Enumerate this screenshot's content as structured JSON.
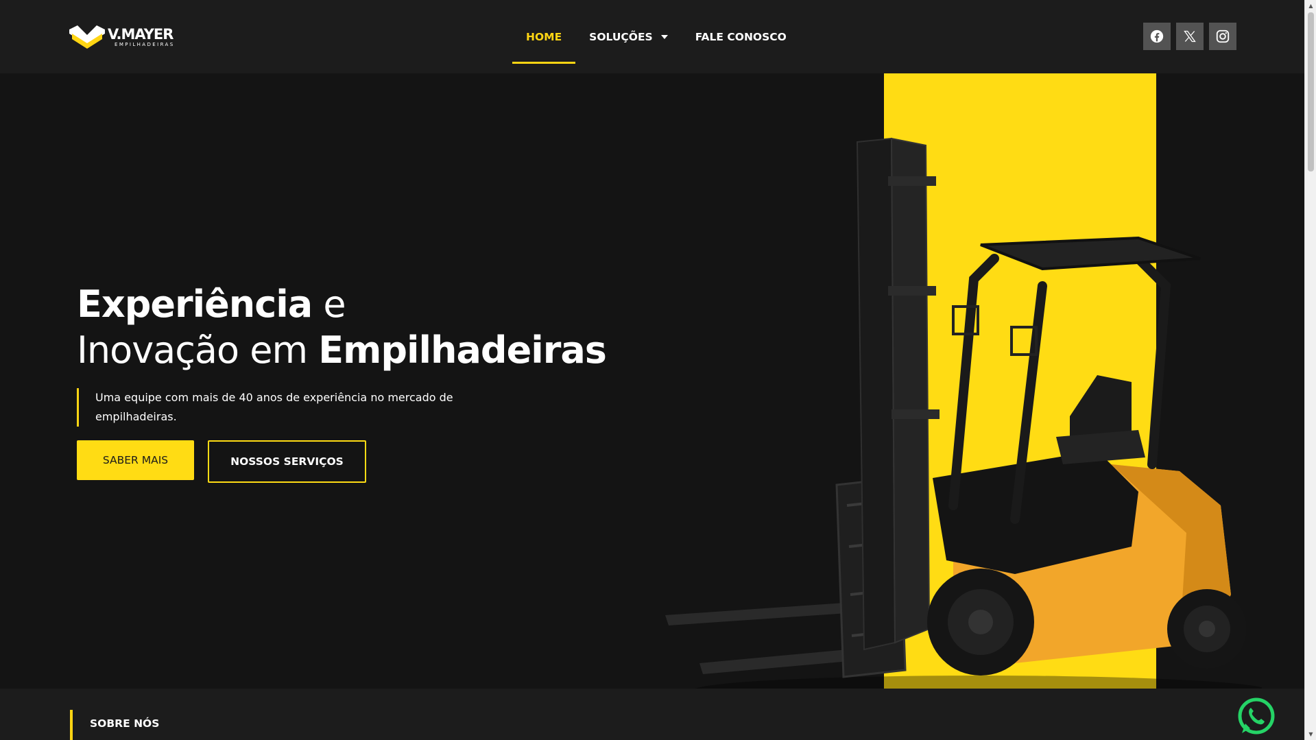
{
  "header": {
    "logo": {
      "brand": "V.MAYER",
      "tagline": "EMPILHADEIRAS"
    },
    "nav": [
      {
        "label": "HOME",
        "active": true
      },
      {
        "label": "SOLUÇÕES",
        "has_dropdown": true
      },
      {
        "label": "FALE CONOSCO"
      }
    ],
    "socials": [
      {
        "name": "facebook-icon"
      },
      {
        "name": "x-twitter-icon"
      },
      {
        "name": "instagram-icon"
      }
    ]
  },
  "hero": {
    "headline_line1_bold": "Experiência",
    "headline_line1_light": " e",
    "headline_line2_light": "Inovação em ",
    "headline_line2_bold": "Empilhadeiras",
    "subtext": "Uma equipe com mais de 40 anos de experiência no mercado de empilhadeiras.",
    "primary_button": "SABER MAIS",
    "secondary_button": "NOSSOS SERVIÇOS"
  },
  "about": {
    "label": "SOBRE NÓS"
  },
  "colors": {
    "accent": "#ffd513",
    "band": "#ffdc14",
    "background": "#141414",
    "header_bg": "#1c1c1c",
    "social_bg": "#535353",
    "whatsapp": "#25d366"
  }
}
